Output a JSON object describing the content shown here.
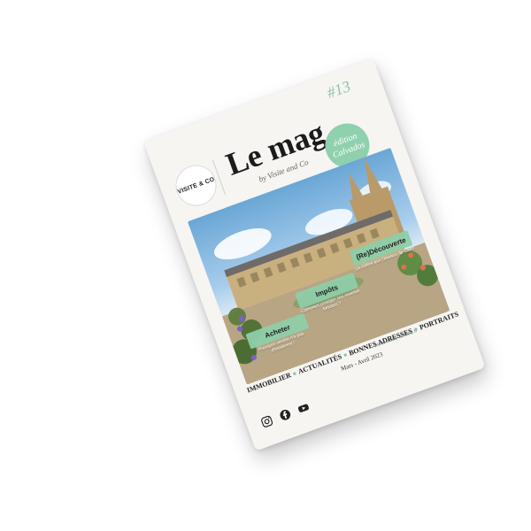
{
  "cover": {
    "issue_number": "#13",
    "logo_text": "VISITE & CO",
    "title": "Le mag",
    "byline": "by Visite and Co",
    "edition_line1": "édition",
    "edition_line2": "Calvados",
    "pills": [
      {
        "title": "Acheter",
        "subtitle": "Pourquoi vendre n'a pas d'incidence !"
      },
      {
        "title": "Impôts",
        "subtitle": "Comment protéger ses revenus fonciers ?"
      },
      {
        "title": "(Re)Découverte",
        "subtitle": "La colline aux Oiseaux de Caen"
      }
    ],
    "website": "www.visite-andco.fr",
    "categories": [
      "IMMOBILIER",
      "ACTUALITÉS",
      "BONNES ADRESSES",
      "PORTRAITS"
    ],
    "date": "Mars - Avril 2023",
    "socials": [
      "instagram-icon",
      "facebook-icon",
      "youtube-icon"
    ],
    "accent_color": "#8bc7a3"
  }
}
